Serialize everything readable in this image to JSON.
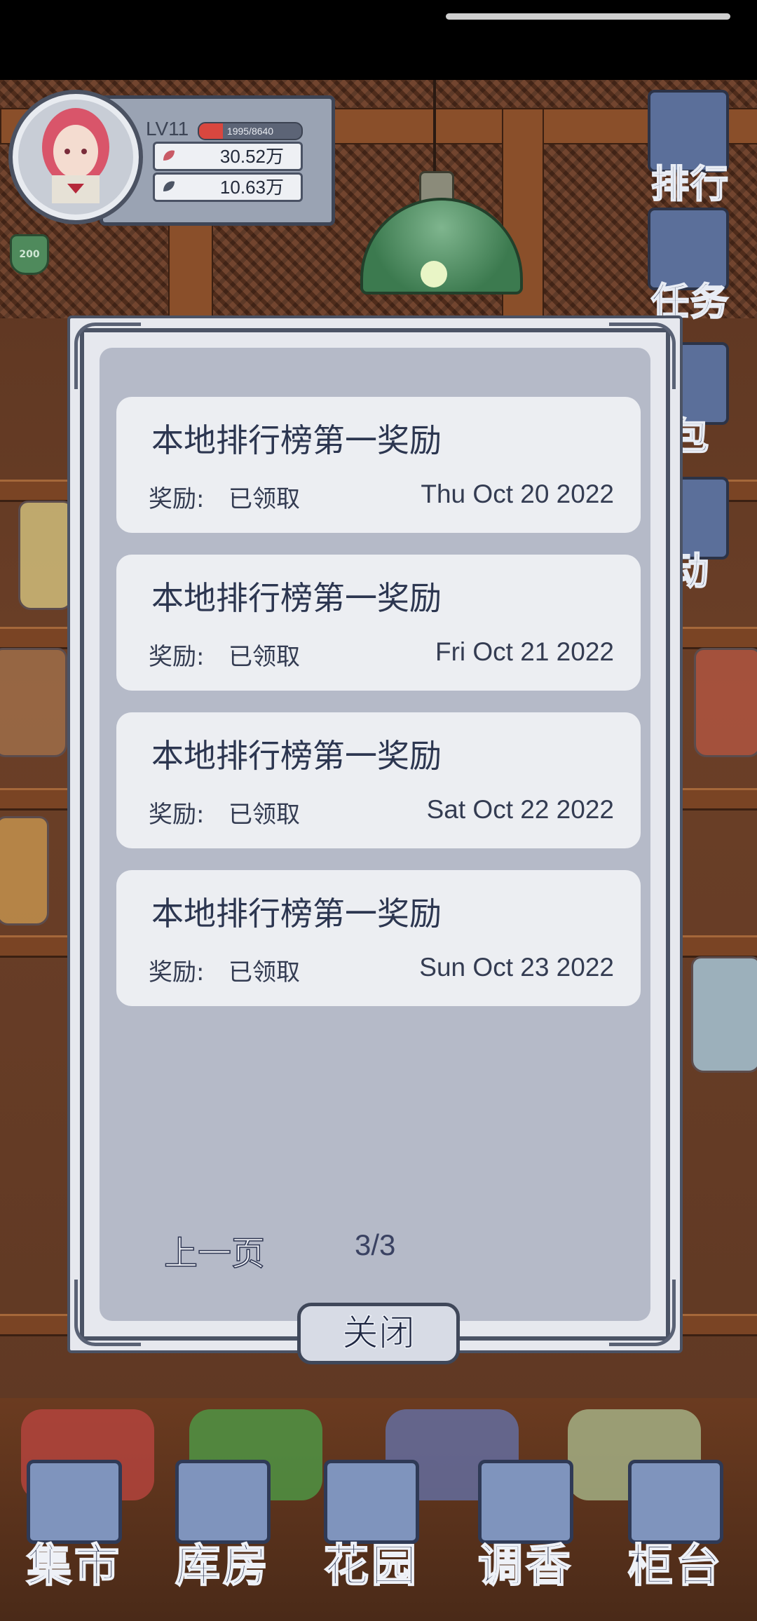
{
  "player": {
    "level": "LV11",
    "xp_text": "1995/8640",
    "xp_progress": 0.231,
    "petals": "30.52万",
    "leaves": "10.63万",
    "badge": "200"
  },
  "side_menu": [
    {
      "label": "排行",
      "icon": "trophy-scroll-icon"
    },
    {
      "label": "任务",
      "icon": "clipboard-icon"
    },
    {
      "label": "包",
      "icon": "bag-icon"
    },
    {
      "label": "动",
      "icon": "cloud-event-icon"
    }
  ],
  "rewards": [
    {
      "title": "本地排行榜第一奖励",
      "status_label": "奖励:",
      "status": "已领取",
      "date": "Thu Oct 20 2022"
    },
    {
      "title": "本地排行榜第一奖励",
      "status_label": "奖励:",
      "status": "已领取",
      "date": "Fri Oct 21 2022"
    },
    {
      "title": "本地排行榜第一奖励",
      "status_label": "奖励:",
      "status": "已领取",
      "date": "Sat Oct 22 2022"
    },
    {
      "title": "本地排行榜第一奖励",
      "status_label": "奖励:",
      "status": "已领取",
      "date": "Sun Oct 23 2022"
    }
  ],
  "pagination": {
    "prev_label": "上一页",
    "indicator": "3/3"
  },
  "close_label": "关闭",
  "bottom_nav": [
    {
      "label": "集市",
      "icon": "market-gate-icon"
    },
    {
      "label": "库房",
      "icon": "warehouse-icon"
    },
    {
      "label": "花园",
      "icon": "rose-icon"
    },
    {
      "label": "调香",
      "icon": "perfume-bottle-icon"
    },
    {
      "label": "柜台",
      "icon": "counter-icon"
    }
  ]
}
